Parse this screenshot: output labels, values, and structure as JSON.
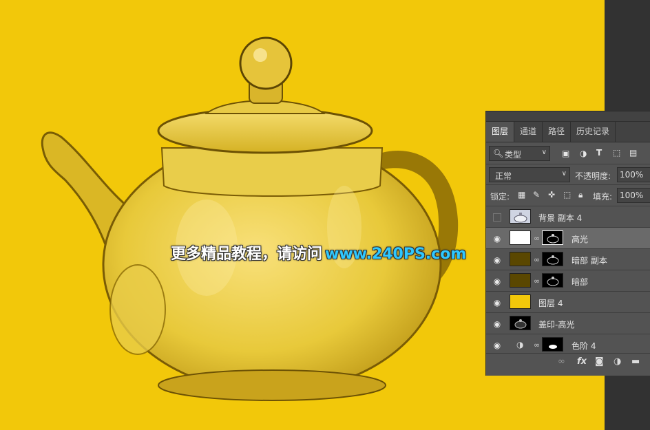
{
  "watermark": {
    "text_cn": "更多精品教程，请访问",
    "url": "www.240PS.com"
  },
  "colors": {
    "canvas": "#f2c80a",
    "panel": "#535353",
    "panel_header": "#424242",
    "selected_layer": "#6a6a6a",
    "watermark_url": "#2fc8ff"
  },
  "layers_panel": {
    "tabs": [
      {
        "label": "图层",
        "active": true
      },
      {
        "label": "通道",
        "active": false
      },
      {
        "label": "路径",
        "active": false
      },
      {
        "label": "历史记录",
        "active": false
      }
    ],
    "filter": {
      "label": "类型",
      "icons": [
        "image-filter-icon",
        "adjustment-filter-icon",
        "type-filter-icon",
        "shape-filter-icon",
        "smart-object-filter-icon"
      ]
    },
    "blend_mode": "正常",
    "opacity_label": "不透明度:",
    "opacity_value": "100%",
    "lock_label": "锁定:",
    "fill_label": "填充:",
    "fill_value": "100%",
    "layers": [
      {
        "name": "背景 副本 4",
        "visible": false,
        "selected": false,
        "thumb": "teapot-gray",
        "mask": null,
        "adjustment": false
      },
      {
        "name": "高光",
        "visible": true,
        "selected": true,
        "thumb": "white",
        "mask": "teapot-mask",
        "adjustment": false
      },
      {
        "name": "暗部 副本",
        "visible": true,
        "selected": false,
        "thumb": "dark-olive",
        "mask": "teapot-mask",
        "adjustment": false
      },
      {
        "name": "暗部",
        "visible": true,
        "selected": false,
        "thumb": "dark-olive",
        "mask": "teapot-mask",
        "adjustment": false
      },
      {
        "name": "图层 4",
        "visible": true,
        "selected": false,
        "thumb": "yellow",
        "mask": null,
        "adjustment": false
      },
      {
        "name": "盖印-高光",
        "visible": true,
        "selected": false,
        "thumb": "teapot-black",
        "mask": null,
        "adjustment": false
      },
      {
        "name": "色阶 4",
        "visible": true,
        "selected": false,
        "thumb": "adjustment",
        "mask": "teapot-mask-small",
        "adjustment": true
      }
    ],
    "bottom_icons": [
      "link-layers-icon",
      "fx-icon",
      "add-mask-icon",
      "new-adjustment-icon",
      "new-group-icon"
    ]
  }
}
